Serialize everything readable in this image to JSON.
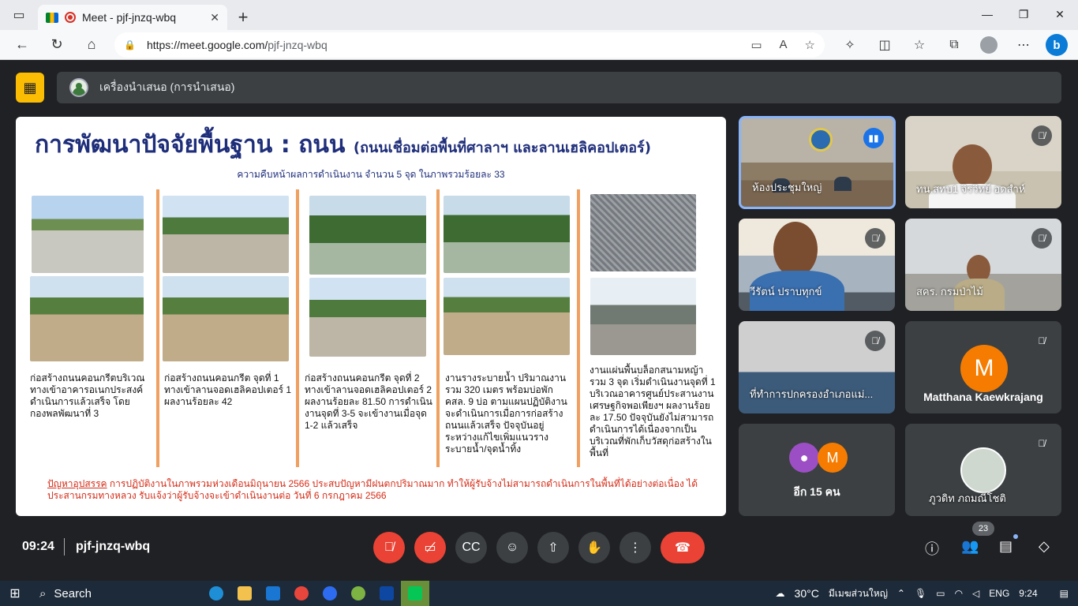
{
  "browser": {
    "tab_title": "Meet - pjf-jnzq-wbq",
    "url_host": "https://meet.google.com/",
    "url_path": "pjf-jnzq-wbq"
  },
  "presenting": {
    "label": "เครื่องนำเสนอ (การนำเสนอ)"
  },
  "slide": {
    "title": "การพัฒนาปัจจัยพื้นฐาน : ถนน",
    "title_sub": "(ถนนเชื่อมต่อพื้นที่ศาลาฯ และลานเฮลิคอปเตอร์)",
    "progress": "ความคืบหน้าผลการดำเนินงาน จำนวน  5 จุด ในภาพรวมร้อยละ  33",
    "captions": [
      "ก่อสร้างถนนคอนกรีตบริเวณทางเข้าอาคารอเนกประสงค์ ดำเนินการแล้วเสร็จ  โดยกองพลพัฒนาที่ 3",
      "ก่อสร้างถนนคอนกรีต จุดที่ 1 ทางเข้าลานจอดเฮลิคอปเตอร์ 1 ผลงานร้อยละ 42",
      "ก่อสร้างถนนคอนกรีต จุดที่ 2 ทางเข้าลานจอดเฮลิคอปเตอร์ 2 ผลงานร้อยละ 81.50 การดำเนินงานจุดที่ 3-5 จะเข้างานเมื่อจุด  1-2 แล้วเสร็จ",
      "งานรางระบายน้ำ ปริมาณงานรวม 320 เมตร พร้อมบ่อพัก คสล. 9 บ่อ ตามแผนปฏิบัติงานจะดำเนินการเมื่อการก่อสร้างถนนแล้วเสร็จ ปัจจุบันอยู่ระหว่างแก้ไขเพิ่มแนวรางระบายน้ำ/จุดน้ำทิ้ง",
      "งานแผ่นพื้นบล็อกสนามหญ้า รวม 3 จุด เริ่มดำเนินงานจุดที่ 1 บริเวณอาคารศูนย์ประสานงานเศรษฐกิจพอเพียงฯ ผลงานร้อยละ 17.50 ปัจจุบันยังไม่สามารถดำเนินการได้เนื่องจากเป็นบริเวณที่พักเก็บวัสดุก่อสร้างในพื้นที่"
    ],
    "obstacle_label": "ปัญหาอุปสรรค",
    "obstacle_text": " การปฏิบัติงานในภาพรวมห่วงเดือนมิถุนายน 2566 ประสบปัญหามีฝนตกปริมาณมาก ทำให้ผู้รับจ้างไม่สามารถดำเนินการในพื้นที่ได้อย่างต่อเนื่อง ได้ประสานกรมทางหลวง รับแจ้งว่าผู้รับจ้างจะเข้าดำเนินงานต่อ วันที่ 6 กรกฎาคม 2566"
  },
  "participants": [
    {
      "name": "ห้องประชุมใหญ่",
      "state": "speaking"
    },
    {
      "name": "ทน.สทบ1 จิรวิทย์ อดสำห์",
      "state": "muted"
    },
    {
      "name": "วีรัตน์ ปราบทุกข์",
      "state": "muted"
    },
    {
      "name": "สคร. กรมป่าไม้",
      "state": "muted"
    },
    {
      "name": "ที่ทำการปกครองอำเภอแม่...",
      "state": "muted"
    },
    {
      "name": "Matthana Kaewkrajang",
      "initial": "M",
      "state": "muted"
    },
    {
      "name": "ภูวดิท ภถมณีโชติ",
      "state": "muted"
    }
  ],
  "others": {
    "label": "อีก 15 คน",
    "initial": "M"
  },
  "bottom": {
    "time": "09:24",
    "meeting_code": "pjf-jnzq-wbq",
    "people_count": "23"
  },
  "taskbar": {
    "search": "Search",
    "weather": "30°C",
    "weather_desc": "มีเมฆส่วนใหญ่",
    "lang": "ENG",
    "clock": "9:24"
  },
  "colors": {
    "accent": "#8ab4f8",
    "hangup": "#ea4335",
    "present_btn": "#fbbc04",
    "avatar_orange": "#f57c00"
  }
}
